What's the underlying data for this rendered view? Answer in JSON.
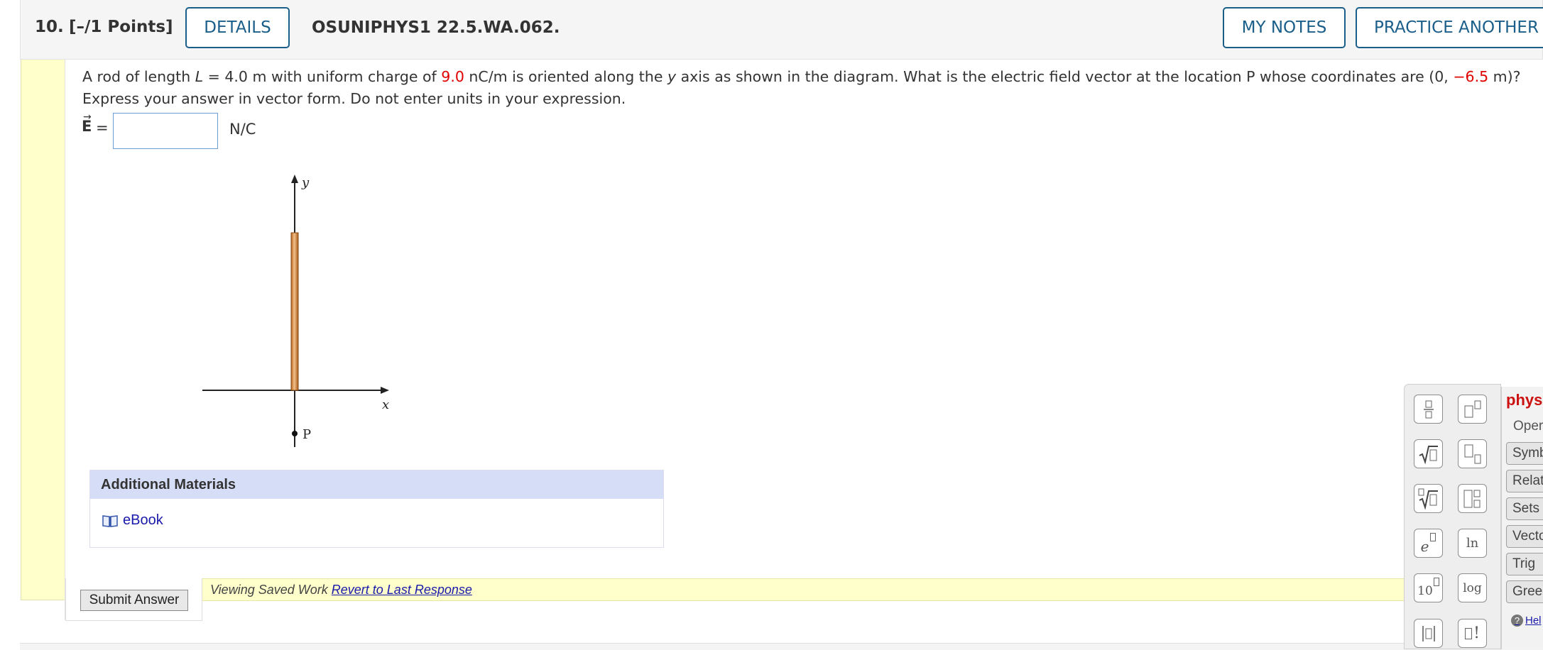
{
  "header": {
    "question_number": "10.",
    "points": "[–/1 Points]",
    "details_label": "DETAILS",
    "problem_code": "OSUNIPHYS1 22.5.WA.062.",
    "my_notes_label": "MY NOTES",
    "practice_label": "PRACTICE ANOTHER"
  },
  "question": {
    "t1": "A rod of length ",
    "var_L": "L",
    "t2": " = 4.0 m with uniform charge of ",
    "charge": "9.0",
    "t3": " nC/m is oriented along the ",
    "var_y": "y",
    "t4": " axis as shown in the diagram. What is the electric field vector at the location P whose coordinates are (0, ",
    "coord": "−6.5",
    "t5": " m)? Express your answer in vector form. Do not enter units in your expression."
  },
  "answer": {
    "arrow": "→",
    "symbol": "E",
    "equals": "=",
    "value": "",
    "unit": "N/C"
  },
  "diagram": {
    "y_label": "y",
    "x_label": "x",
    "point_label": "P"
  },
  "additional_materials": {
    "title": "Additional Materials",
    "ebook_label": "eBook"
  },
  "submit": {
    "button_label": "Submit Answer",
    "saved_text": "Viewing Saved Work",
    "revert_label": "Revert to Last Response"
  },
  "palette": {
    "ln_label": "ln",
    "log_label": "log",
    "ten_label": "10",
    "e_label": "e",
    "fact_label": "!",
    "phys_title": "phys",
    "operations_label": "Oper",
    "categories": [
      "Symb",
      "Relat",
      "Sets",
      "Vecto",
      "Trig",
      "Greel"
    ],
    "help_label": "Hel"
  }
}
